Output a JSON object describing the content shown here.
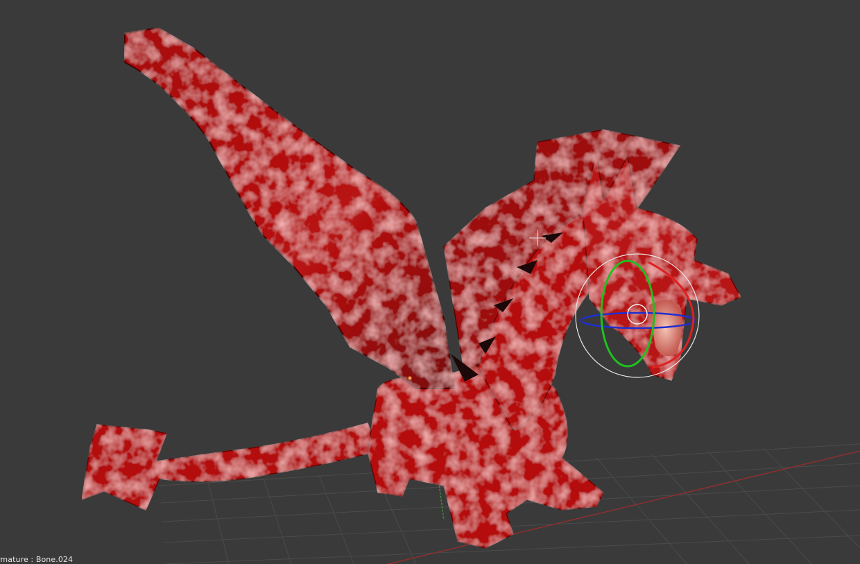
{
  "viewport": {
    "status_text": "rmature : Bone.024"
  },
  "colors": {
    "background": "#3a3a3a",
    "grid": "#4b4b4b",
    "x_axis": "#8e2f2f",
    "y_axis": "#3f8f3f",
    "dragon": "#b01010",
    "gizmo_x": "#e02020",
    "gizmo_y": "#20c020",
    "gizmo_z": "#1f2fd0",
    "gizmo_view": "#e8e8e8"
  },
  "scene": {
    "object": "dragon-model",
    "active_bone": "Bone.024",
    "gizmo": "rotate"
  }
}
